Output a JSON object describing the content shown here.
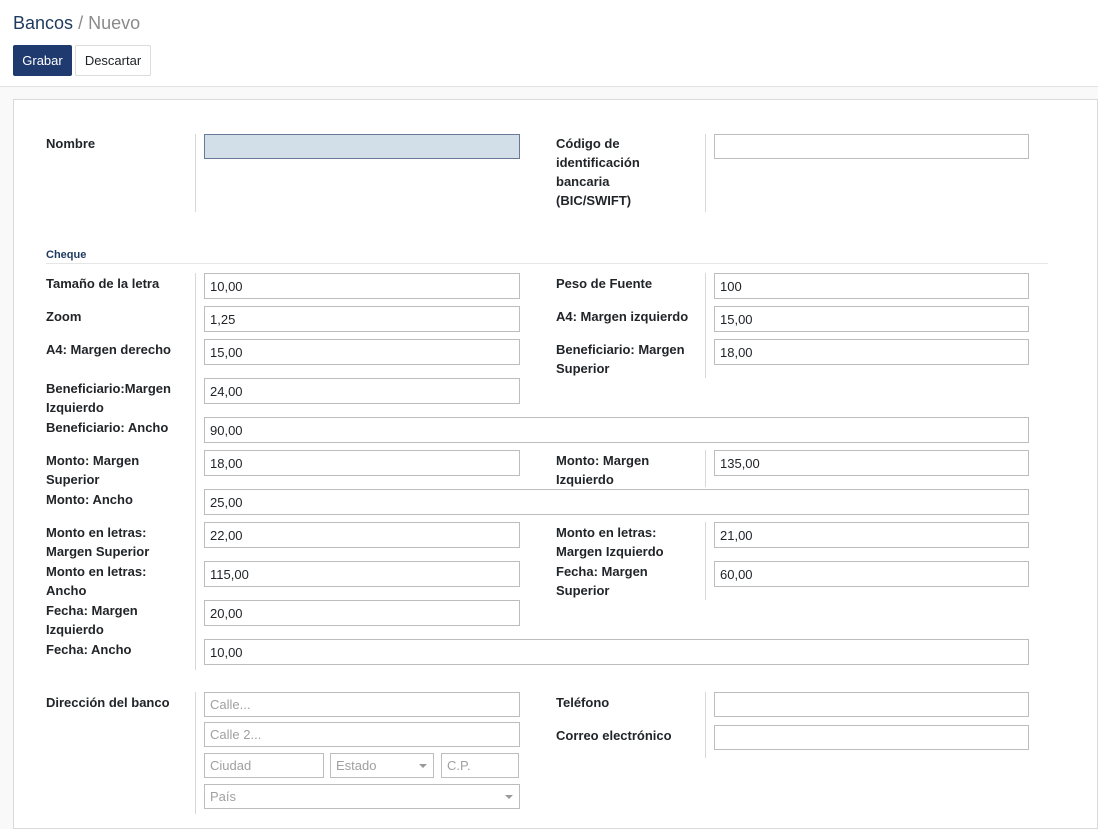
{
  "breadcrumb": {
    "parent": "Bancos",
    "separator": "/",
    "current": "Nuevo"
  },
  "buttons": {
    "save": "Grabar",
    "discard": "Descartar"
  },
  "form": {
    "name_label": "Nombre",
    "name_value": "",
    "bic_label": [
      "Código de",
      "identificación",
      "bancaria",
      "(BIC/SWIFT)"
    ],
    "bic_value": "",
    "group_check": "Cheque",
    "fields": {
      "font_size": {
        "label": "Tamaño de la letra",
        "value": "10,00"
      },
      "font_weight": {
        "label": "Peso de Fuente",
        "value": "100"
      },
      "zoom": {
        "label": "Zoom",
        "value": "1,25"
      },
      "a4_left": {
        "label": "A4: Margen izquierdo",
        "value": "15,00"
      },
      "a4_right": {
        "label": "A4: Margen derecho",
        "value": "15,00"
      },
      "payee_top": {
        "label": [
          "Beneficiario: Margen",
          "Superior"
        ],
        "value": "18,00"
      },
      "payee_left": {
        "label": [
          "Beneficiario:Margen",
          "Izquierdo"
        ],
        "value": "24,00"
      },
      "payee_width": {
        "label": "Beneficiario: Ancho",
        "value": "90,00"
      },
      "amount_top": {
        "label": [
          "Monto: Margen",
          "Superior"
        ],
        "value": "18,00"
      },
      "amount_left": {
        "label": [
          "Monto: Margen",
          "Izquierdo"
        ],
        "value": "135,00"
      },
      "amount_width": {
        "label": "Monto: Ancho",
        "value": "25,00"
      },
      "words_top": {
        "label": [
          "Monto en letras:",
          "Margen Superior"
        ],
        "value": "22,00"
      },
      "words_left": {
        "label": [
          "Monto en letras:",
          "Margen Izquierdo"
        ],
        "value": "21,00"
      },
      "words_width": {
        "label": [
          "Monto en letras:",
          "Ancho"
        ],
        "value": "115,00"
      },
      "date_top": {
        "label": [
          "Fecha: Margen",
          "Superior"
        ],
        "value": "60,00"
      },
      "date_left": {
        "label": [
          "Fecha: Margen",
          "Izquierdo"
        ],
        "value": "20,00"
      },
      "date_width": {
        "label": "Fecha: Ancho",
        "value": "10,00"
      }
    },
    "address": {
      "label": "Dirección del banco",
      "street_placeholder": "Calle...",
      "street2_placeholder": "Calle 2...",
      "city_placeholder": "Ciudad",
      "state_placeholder": "Estado",
      "zip_placeholder": "C.P.",
      "country_placeholder": "País"
    },
    "phone_label": "Teléfono",
    "phone_value": "",
    "email_label": "Correo electrónico",
    "email_value": ""
  }
}
